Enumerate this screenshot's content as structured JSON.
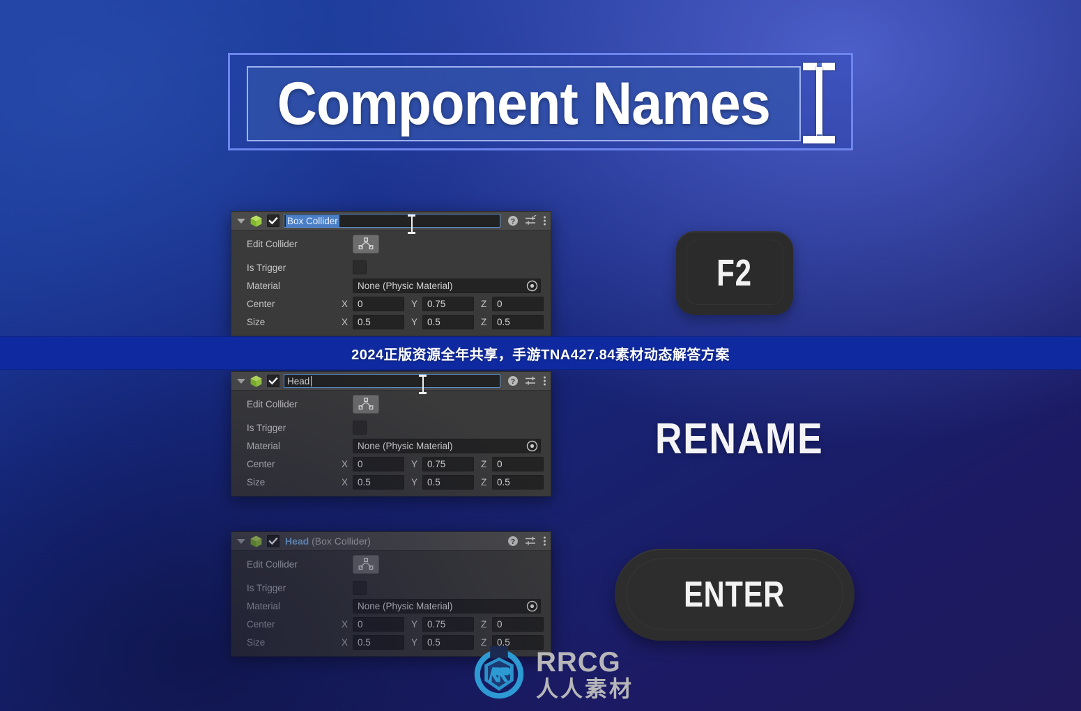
{
  "title_box": {
    "text": "Component Names",
    "cursor_icon": "text-ibeam-cursor-icon"
  },
  "banner": {
    "text": "2024正版资源全年共享，手游TNA427.84素材动态解答方案"
  },
  "keys": {
    "f2_label": "F2",
    "rename_label": "RENAME",
    "enter_label": "ENTER"
  },
  "watermark": {
    "brand": "RRCG",
    "subtitle": "人人素材"
  },
  "labels": {
    "edit_collider": "Edit Collider",
    "is_trigger": "Is Trigger",
    "material": "Material",
    "center": "Center",
    "size": "Size",
    "axis_x": "X",
    "axis_y": "Y",
    "axis_z": "Z"
  },
  "colors": {
    "panel_bg": "#3a3a3a",
    "panel_header": "#4a4a4a",
    "field_bg": "#232323",
    "selection_blue": "#4a7fc7",
    "component_name_blue": "#7fb4e8",
    "cube_green": "#a4d64b",
    "banner_blue": "#0f2aa0",
    "title_border": "#6d86ee"
  },
  "panels": [
    {
      "id": "panel-box-collider-selected",
      "name_field": {
        "state": "editing-selected",
        "selected_text": "Box Collider",
        "trailing_text": ""
      },
      "material_value": "None (Physic Material)",
      "center": {
        "x": "0",
        "y": "0.75",
        "z": "0"
      },
      "size": {
        "x": "0.5",
        "y": "0.5",
        "z": "0.5"
      }
    },
    {
      "id": "panel-head-typing",
      "name_field": {
        "state": "editing-typed",
        "selected_text": "",
        "trailing_text": "Head"
      },
      "material_value": "None (Physic Material)",
      "center": {
        "x": "0",
        "y": "0.75",
        "z": "0"
      },
      "size": {
        "x": "0.5",
        "y": "0.5",
        "z": "0.5"
      }
    },
    {
      "id": "panel-head-committed",
      "name_field": {
        "state": "committed",
        "component_name": "Head",
        "component_type": "(Box Collider)"
      },
      "material_value": "None (Physic Material)",
      "center": {
        "x": "0",
        "y": "0.75",
        "z": "0"
      },
      "size": {
        "x": "0.5",
        "y": "0.5",
        "z": "0.5"
      }
    }
  ]
}
